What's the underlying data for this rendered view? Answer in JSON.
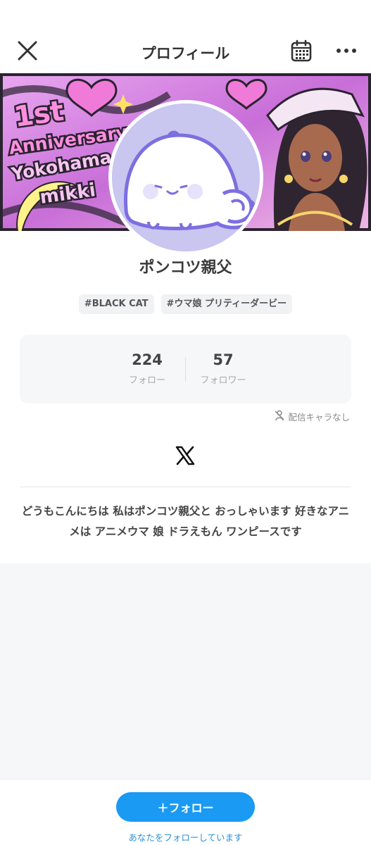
{
  "header": {
    "title": "プロフィール",
    "close_icon": "close-icon",
    "calendar_icon": "calendar-icon",
    "more_icon": "more-dots-icon"
  },
  "banner": {
    "line1": "1st",
    "line2": "Anniversary",
    "line3": "Yokohama",
    "line4": "mikki"
  },
  "profile": {
    "name": "ポンコツ親父",
    "tags": [
      "#BLACK CAT",
      "#ウマ娘 プリティーダービー"
    ]
  },
  "stats": {
    "follow_count": "224",
    "follow_label": "フォロー",
    "follower_count": "57",
    "follower_label": "フォロワー"
  },
  "no_character": "配信キャラなし",
  "social": {
    "x_icon": "x-logo-icon"
  },
  "bio": "どうもこんにちは 私はポンコツ親父と おっしゃいます 好きなアニメは アニメウマ 娘 ドラえもん ワンピースです",
  "bottom": {
    "follow_button": "＋フォロー",
    "follows_you": "あなたをフォローしています"
  },
  "colors": {
    "accent": "#1a9af2",
    "banner_pink": "#d887e6",
    "avatar_bg": "#c9c6ef"
  }
}
